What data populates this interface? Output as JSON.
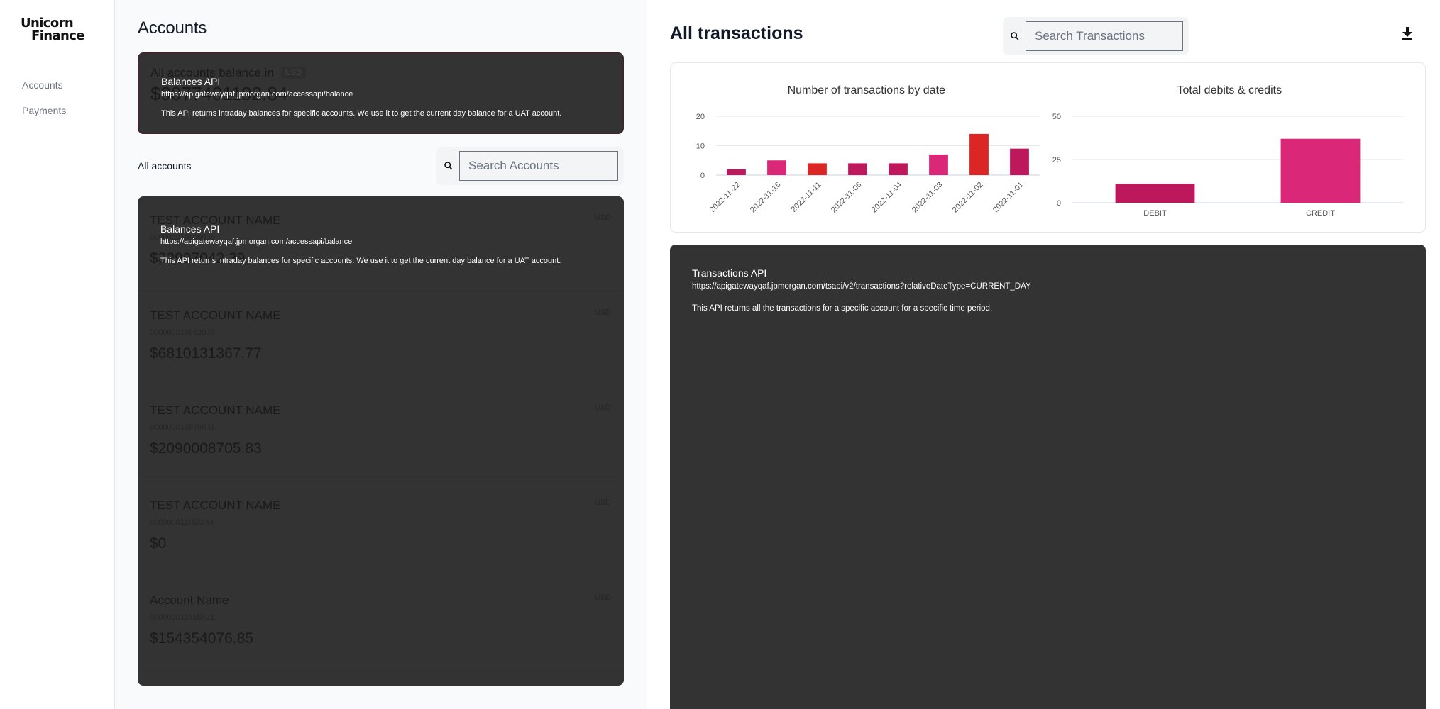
{
  "brand": {
    "line1": "Unicorn",
    "line2": "Finance"
  },
  "sidebar": {
    "items": [
      {
        "label": "Accounts"
      },
      {
        "label": "Payments"
      }
    ]
  },
  "accounts": {
    "title": "Accounts",
    "balance_card": {
      "label": "All accounts balance in",
      "currency": "USD",
      "value": "$9077401192.84"
    },
    "balances_api": {
      "title": "Balances API",
      "url": "https://apigatewayqaf.jpmorgan.com/accessapi/balance",
      "description": "This API returns intraday balances for specific accounts. We use it to get the current day balance for a UAT account."
    },
    "list_title": "All accounts",
    "search_placeholder": "Search Accounts",
    "items": [
      {
        "name": "TEST ACCOUNT NAME",
        "number": "000000010800009",
        "balance": "$32907042.39",
        "currency": "USD"
      },
      {
        "name": "TEST ACCOUNT NAME",
        "number": "000000010962009",
        "balance": "$6810131367.77",
        "currency": "USD"
      },
      {
        "name": "TEST ACCOUNT NAME",
        "number": "000000010975001",
        "balance": "$2090008705.83",
        "currency": "USD"
      },
      {
        "name": "TEST ACCOUNT NAME",
        "number": "000000011153244",
        "balance": "$0",
        "currency": "USD"
      },
      {
        "name": "Account Name",
        "number": "000000011315421",
        "balance": "$154354076.85",
        "currency": "USD"
      }
    ]
  },
  "transactions": {
    "title": "All transactions",
    "search_placeholder": "Search Transactions",
    "download_icon": "download-icon",
    "api": {
      "title": "Transactions API",
      "url": "https://apigatewayqaf.jpmorgan.com/tsapi/v2/transactions?relativeDateType=CURRENT_DAY",
      "description": "This API returns all the transactions for a specific account for a specific time period."
    }
  },
  "colors": {
    "crimson": "#be185d",
    "pink": "#db2777",
    "red": "#dc2626",
    "dark_panel": "#333333"
  },
  "chart_data": [
    {
      "type": "bar",
      "title": "Number of transactions by date",
      "categories": [
        "2022-11-22",
        "2022-11-16",
        "2022-11-11",
        "2022-11-06",
        "2022-11-04",
        "2022-11-03",
        "2022-11-02",
        "2022-11-01"
      ],
      "values": [
        2,
        5,
        4,
        4,
        4,
        7,
        14,
        9
      ],
      "bar_colors": [
        "#be185d",
        "#db2777",
        "#dc2626",
        "#be185d",
        "#be185d",
        "#db2777",
        "#dc2626",
        "#be185d"
      ],
      "yticks": [
        0,
        10,
        20
      ],
      "ylim": [
        0,
        20
      ],
      "xlabel": "",
      "ylabel": "",
      "grid": true,
      "legend": "none"
    },
    {
      "type": "bar",
      "title": "Total debits & credits",
      "categories": [
        "DEBIT",
        "CREDIT"
      ],
      "values": [
        11,
        37
      ],
      "bar_colors": [
        "#be185d",
        "#db2777"
      ],
      "yticks": [
        0,
        25,
        50
      ],
      "ylim": [
        0,
        50
      ],
      "xlabel": "",
      "ylabel": "",
      "grid": true,
      "legend": "none"
    }
  ]
}
